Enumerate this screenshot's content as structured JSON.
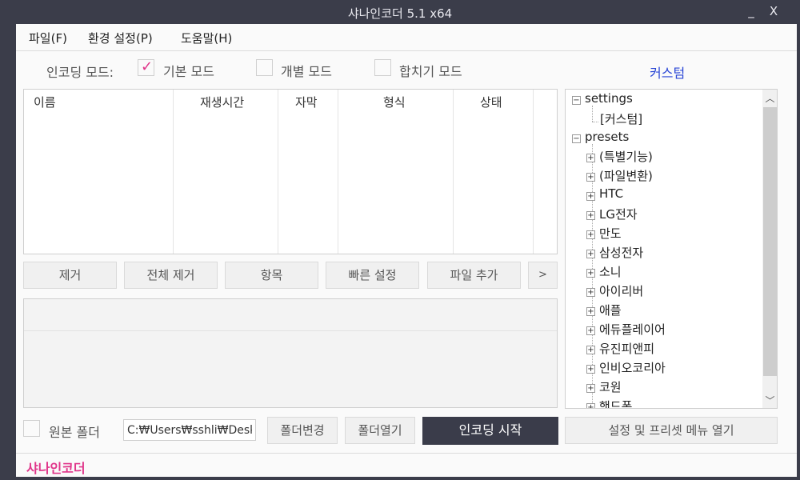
{
  "window": {
    "title": "샤나인코더  5.1 x64",
    "minimize": "_",
    "close": "X"
  },
  "menu": [
    "파일(F)",
    "환경 설정(P)",
    "도움말(H)"
  ],
  "mode": {
    "label": "인코딩 모드:",
    "options": [
      {
        "label": "기본 모드",
        "checked": true
      },
      {
        "label": "개별 모드",
        "checked": false
      },
      {
        "label": "합치기 모드",
        "checked": false
      }
    ],
    "custom_link": "커스텀"
  },
  "filelist": {
    "columns": [
      "이름",
      "재생시간",
      "자막",
      "형식",
      "상태"
    ]
  },
  "action_buttons": [
    "제거",
    "전체 제거",
    "항목",
    "빠른 설정",
    "파일 추가",
    ">"
  ],
  "tree": {
    "settings": {
      "label": "settings",
      "children": [
        "[커스텀]"
      ]
    },
    "presets": {
      "label": "presets",
      "children": [
        "(특별기능)",
        "(파일변환)",
        "HTC",
        "LG전자",
        "만도",
        "삼성전자",
        "소니",
        "아이리버",
        "애플",
        "에듀플레이어",
        "유진피앤피",
        "인비오코리아",
        "코원",
        "핸드폰"
      ]
    },
    "toggle_minus": "−",
    "toggle_plus": "+"
  },
  "bottom": {
    "origin_folder_label": "원본 폴더",
    "origin_folder_checked": false,
    "path_value": "C:₩Users₩sshli₩Desk",
    "change_folder": "폴더변경",
    "open_folder": "폴더열기",
    "start_encoding": "인코딩 시작",
    "open_settings_menu": "설정 및 프리셋 메뉴 열기"
  },
  "status": {
    "brand": "샤나인코더"
  },
  "colors": {
    "accent": "#e0358a",
    "link": "#2a47d6",
    "titlebar": "#3b3d4a"
  }
}
